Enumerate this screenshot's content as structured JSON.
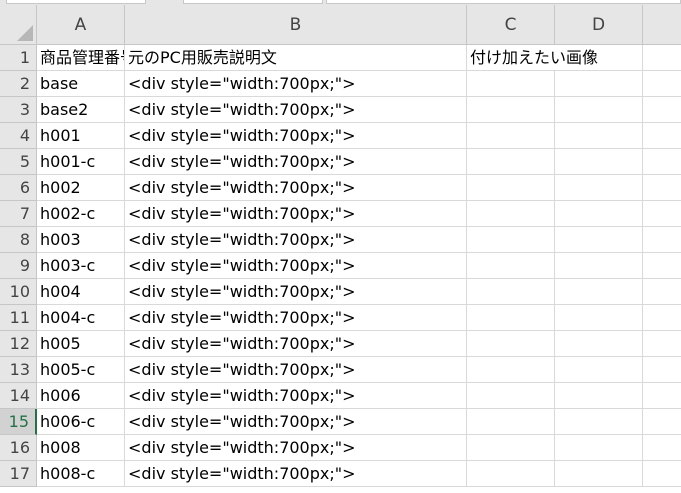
{
  "columns": [
    "A",
    "B",
    "C",
    "D"
  ],
  "header_row": {
    "number": "1",
    "a": "商品管理番号",
    "b": "元のPC用販売説明文",
    "c": "付け加えたい画像",
    "d": ""
  },
  "rows": [
    {
      "n": "2",
      "a": "base",
      "b": "<div style=\"width:700px;\">"
    },
    {
      "n": "3",
      "a": "base2",
      "b": "<div style=\"width:700px;\">"
    },
    {
      "n": "4",
      "a": "h001",
      "b": "<div style=\"width:700px;\">"
    },
    {
      "n": "5",
      "a": "h001-c",
      "b": "<div style=\"width:700px;\">"
    },
    {
      "n": "6",
      "a": "h002",
      "b": "<div style=\"width:700px;\">"
    },
    {
      "n": "7",
      "a": "h002-c",
      "b": "<div style=\"width:700px;\">"
    },
    {
      "n": "8",
      "a": "h003",
      "b": "<div style=\"width:700px;\">"
    },
    {
      "n": "9",
      "a": "h003-c",
      "b": "<div style=\"width:700px;\">"
    },
    {
      "n": "10",
      "a": "h004",
      "b": "<div style=\"width:700px;\">"
    },
    {
      "n": "11",
      "a": "h004-c",
      "b": "<div style=\"width:700px;\">"
    },
    {
      "n": "12",
      "a": "h005",
      "b": "<div style=\"width:700px;\">"
    },
    {
      "n": "13",
      "a": "h005-c",
      "b": "<div style=\"width:700px;\">"
    },
    {
      "n": "14",
      "a": "h006",
      "b": "<div style=\"width:700px;\">"
    },
    {
      "n": "15",
      "a": "h006-c",
      "b": "<div style=\"width:700px;\">"
    },
    {
      "n": "16",
      "a": "h008",
      "b": "<div style=\"width:700px;\">"
    },
    {
      "n": "17",
      "a": "h008-c",
      "b": "<div style=\"width:700px;\">"
    }
  ],
  "active_row": "15",
  "colors": {
    "header_bg": "#e6e6e6",
    "gridline": "#d9d9d9",
    "active_accent": "#217346"
  }
}
